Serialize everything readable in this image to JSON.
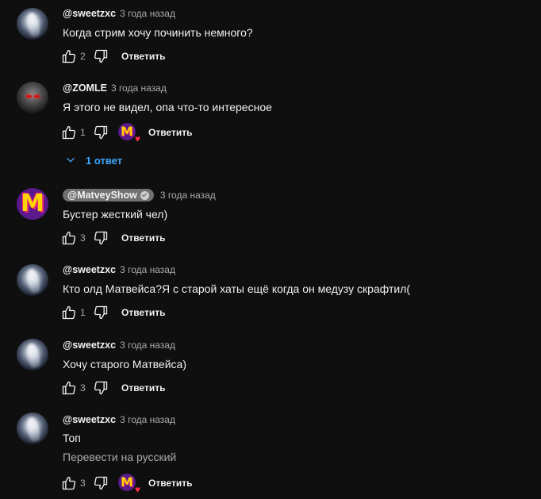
{
  "reply_label": "Ответить",
  "translate_label": "Перевести на русский",
  "comments": [
    {
      "author": "@sweetzxc",
      "time": "3 года назад",
      "text": "Когда стрим хочу починить немного?",
      "likes": "2"
    },
    {
      "author": "@ZOMLE",
      "time": "3 года назад",
      "text": "Я этого не видел, опа что-то интересное",
      "likes": "1",
      "replies_label": "1 ответ"
    },
    {
      "author": "@MatveyShow",
      "time": "3 года назад",
      "text": "Бустер жесткий чел)",
      "likes": "3"
    },
    {
      "author": "@sweetzxc",
      "time": "3 года назад",
      "text": "Кто олд Матвейса?Я с старой хаты ещё когда он медузу скрафтил(",
      "likes": "1"
    },
    {
      "author": "@sweetzxc",
      "time": "3 года назад",
      "text": "Хочу старого Матвейса)",
      "likes": "3"
    },
    {
      "author": "@sweetzxc",
      "time": "3 года назад",
      "text": "Топ",
      "likes": "3"
    }
  ],
  "avatar_letter": "M",
  "icons": {
    "like": "thumb-up-icon",
    "dislike": "thumb-down-icon",
    "heart": "heart-icon",
    "chevron": "chevron-down-icon",
    "verified": "verified-check-icon"
  },
  "colors": {
    "background": "#0f0f0f",
    "text": "#f1f1f1",
    "secondary": "#aaaaaa",
    "link": "#3ea6ff",
    "heart": "#ff2d4a"
  }
}
